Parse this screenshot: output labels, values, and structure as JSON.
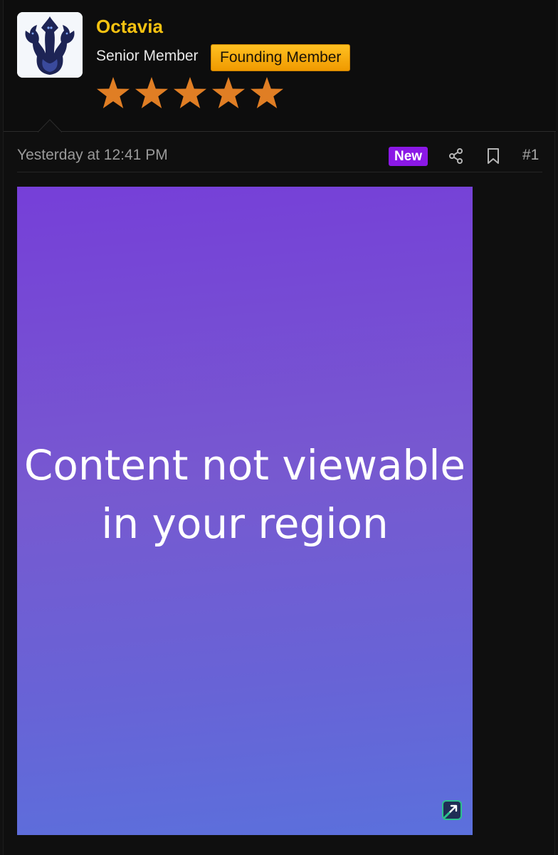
{
  "user": {
    "name": "Octavia",
    "title": "Senior Member",
    "banner": "Founding Member",
    "avatar_icon": "hydra-avatar",
    "star_rating": 5,
    "star_color": "#e07e24"
  },
  "post": {
    "date": "Yesterday at 12:41 PM",
    "new_label": "New",
    "number": "#1",
    "actions": [
      "share-icon",
      "bookmark-icon"
    ]
  },
  "media": {
    "message_line1": "Content not viewable",
    "message_line2": "in your region",
    "gradient_colors": [
      "#763fd8",
      "#5b70dc"
    ]
  },
  "colors": {
    "username": "#f5c211",
    "new_badge": "#8b18e6",
    "banner": "#ffb414"
  }
}
